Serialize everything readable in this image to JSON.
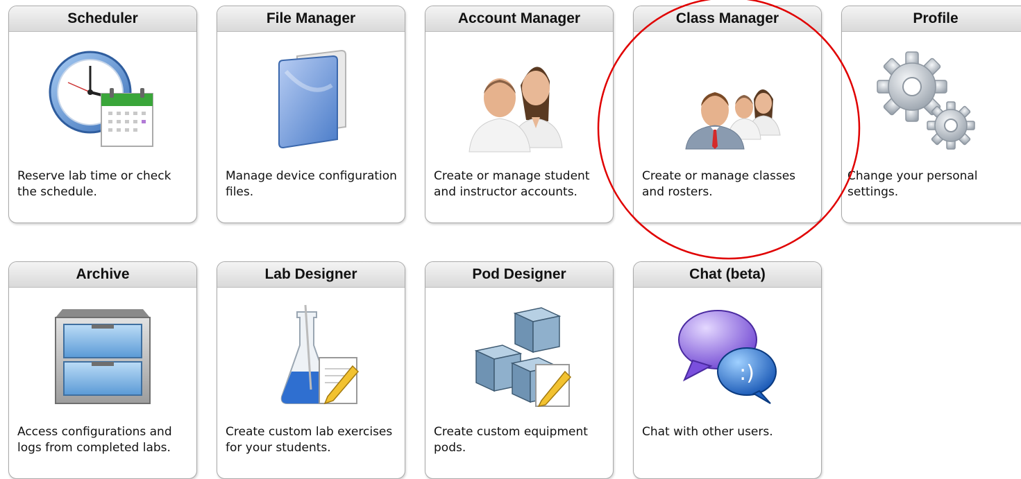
{
  "tiles": [
    {
      "key": "scheduler",
      "title": "Scheduler",
      "description": "Reserve lab time or check the schedule.",
      "icon": "clock-calendar-icon"
    },
    {
      "key": "file-manager",
      "title": "File Manager",
      "description": "Manage device configuration files.",
      "icon": "folder-icon"
    },
    {
      "key": "account-manager",
      "title": "Account Manager",
      "description": "Create or manage student and instructor accounts.",
      "icon": "users-icon"
    },
    {
      "key": "class-manager",
      "title": "Class Manager",
      "description": "Create or manage classes and rosters.",
      "icon": "class-group-icon"
    },
    {
      "key": "profile",
      "title": "Profile",
      "description": "Change your personal settings.",
      "icon": "gears-icon"
    },
    {
      "key": "archive",
      "title": "Archive",
      "description": "Access configurations and logs from completed labs.",
      "icon": "cabinet-icon"
    },
    {
      "key": "lab-designer",
      "title": "Lab Designer",
      "description": "Create custom lab exercises for your students.",
      "icon": "flask-icon"
    },
    {
      "key": "pod-designer",
      "title": "Pod Designer",
      "description": "Create custom equipment pods.",
      "icon": "cubes-icon"
    },
    {
      "key": "chat",
      "title": "Chat (beta)",
      "description": "Chat with other users.",
      "icon": "chat-bubbles-icon"
    }
  ],
  "annotation": {
    "color": "#e00000",
    "target": "class-manager"
  }
}
